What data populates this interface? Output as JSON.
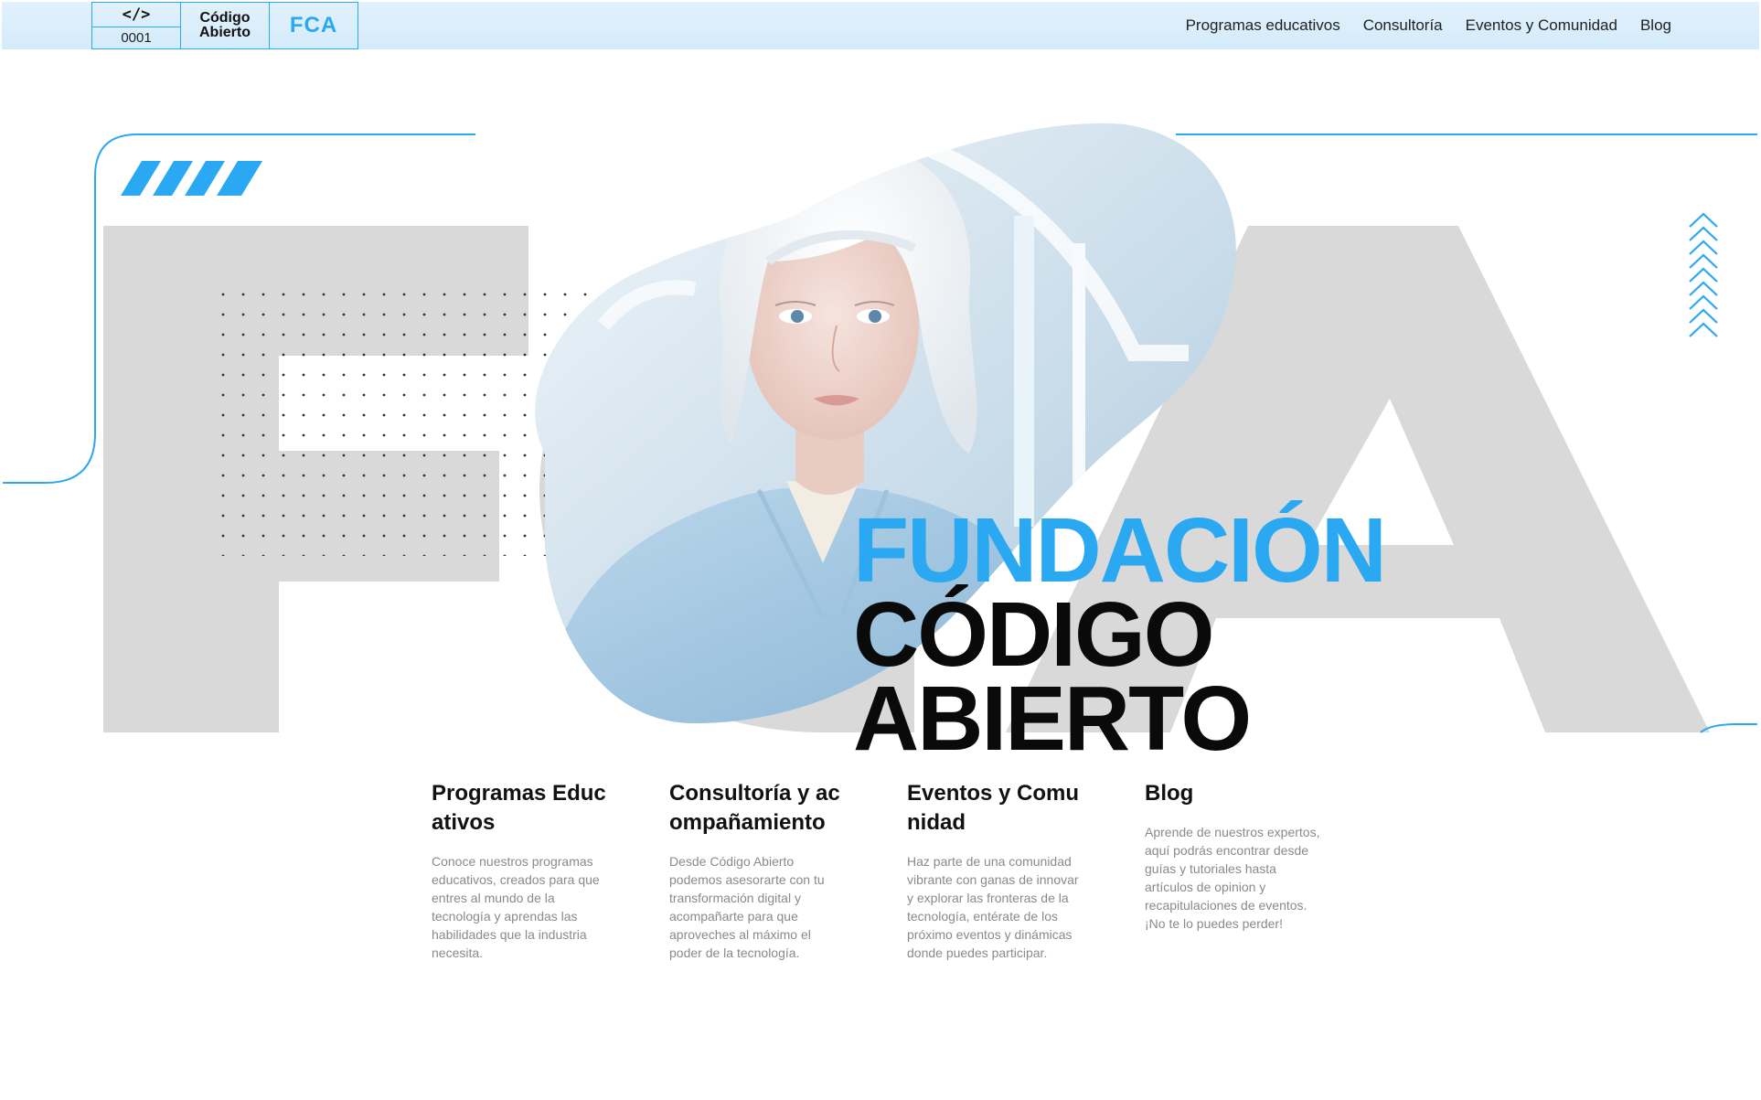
{
  "logo": {
    "code_tag": "</>",
    "code_number": "0001",
    "name_line1": "Código",
    "name_line2": "Abierto",
    "acronym": "FCA"
  },
  "nav": {
    "items": [
      {
        "label": "Programas educativos"
      },
      {
        "label": "Consultoría"
      },
      {
        "label": "Eventos y Comunidad"
      },
      {
        "label": "Blog"
      }
    ]
  },
  "hero": {
    "title_line1": "FUNDACIÓN",
    "title_line2": "CÓDIGO",
    "title_line3": "ABIERTO",
    "background_letters": "FCA",
    "image_subject": "Portrait of a woman with short platinum hair in a light blue jacket",
    "colors": {
      "accent": "#2aa8f2",
      "letters": "#d9d9d9",
      "text": "#0a0a0a"
    }
  },
  "cards": [
    {
      "title": "Programas Educativos",
      "text": "Conoce nuestros programas educativos, creados para que entres al mundo de la tecnología y aprendas las habilidades que la industria necesita."
    },
    {
      "title": "Consultoría y acompañamiento",
      "text": "Desde Código Abierto podemos asesorarte con tu transformación digital y acompañarte para que aproveches al máximo el poder de la tecnología."
    },
    {
      "title": "Eventos y Comunidad",
      "text": "Haz parte de una comunidad vibrante con ganas de innovar y explorar las fronteras de la tecnología, entérate de los próximo eventos y dinámicas donde puedes participar."
    },
    {
      "title": "Blog",
      "text": "Aprende de nuestros expertos, aquí podrás encontrar desde guías y tutoriales hasta artículos de opinion y recapitulaciones de eventos. ¡No te lo puedes perder!"
    }
  ]
}
